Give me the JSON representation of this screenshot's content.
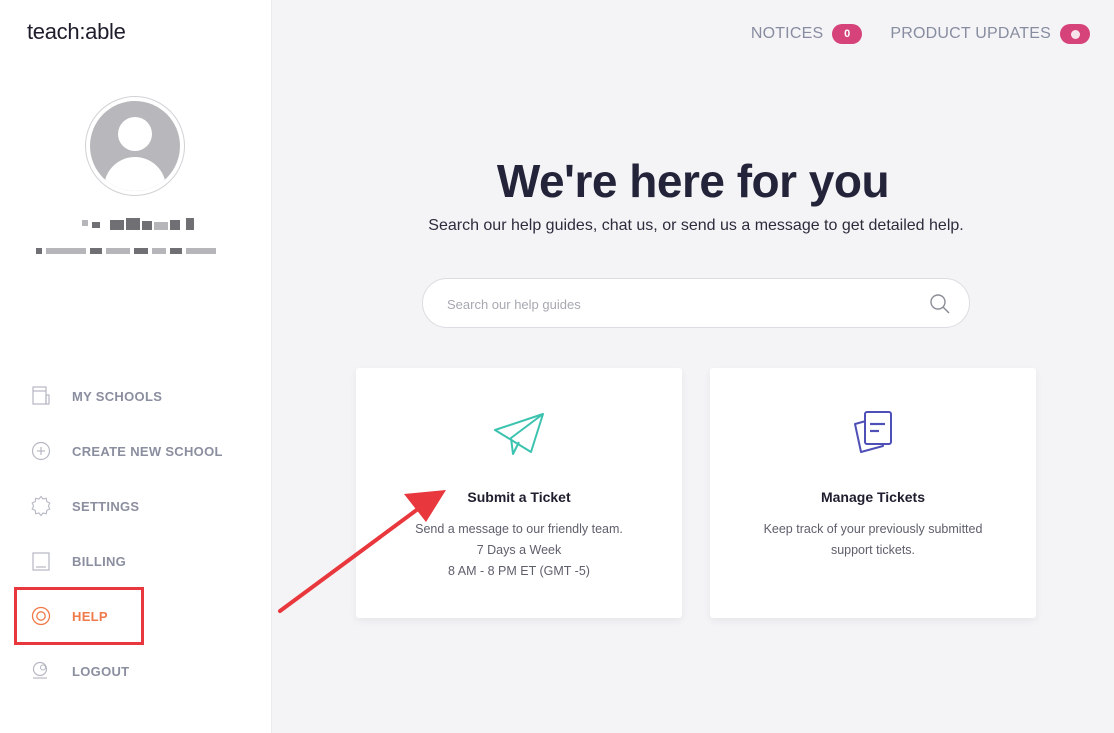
{
  "brand": {
    "logo_text": "teach:able"
  },
  "topbar": {
    "notices_label": "NOTICES",
    "notices_count": "0",
    "updates_label": "PRODUCT UPDATES"
  },
  "sidebar": {
    "items": [
      {
        "label": "MY SCHOOLS",
        "icon": "building-icon"
      },
      {
        "label": "CREATE NEW SCHOOL",
        "icon": "plus-circle-icon"
      },
      {
        "label": "SETTINGS",
        "icon": "gear-icon"
      },
      {
        "label": "BILLING",
        "icon": "receipt-icon"
      },
      {
        "label": "HELP",
        "icon": "lifebuoy-icon",
        "active": true
      },
      {
        "label": "LOGOUT",
        "icon": "logout-icon"
      }
    ]
  },
  "main": {
    "title": "We're here for you",
    "subtitle": "Search our help guides, chat us, or send us a message to get detailed help.",
    "search_placeholder": "Search our help guides",
    "cards": [
      {
        "title": "Submit a Ticket",
        "lines": [
          "Send a message to our friendly team.",
          "7 Days a Week",
          "8 AM - 8 PM ET (GMT -5)"
        ],
        "icon": "paper-plane-icon"
      },
      {
        "title": "Manage Tickets",
        "lines": [
          "Keep track of your previously submitted",
          "support tickets."
        ],
        "icon": "documents-icon"
      }
    ]
  },
  "colors": {
    "accent_active": "#f07a4a",
    "badge": "#d6437a",
    "annotation_red": "#e8383d",
    "plane_teal": "#3cc3b0",
    "docs_indigo": "#4f4fb8"
  }
}
